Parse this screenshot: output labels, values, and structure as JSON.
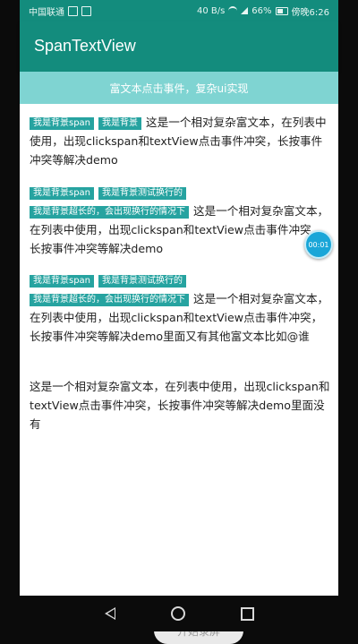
{
  "status_bar": {
    "carrier": "中国联通",
    "net_speed": "40 B/s",
    "battery": "66%",
    "time": "傍晚6:26"
  },
  "app": {
    "title": "SpanTextView"
  },
  "banner": {
    "text": "富文本点击事件，复杂ui实现"
  },
  "paragraphs": [
    {
      "tags": [
        "我是背景span",
        "我是背景"
      ],
      "text": "这是一个相对复杂富文本，在列表中使用，出现clickspan和textView点击事件冲突，长按事件冲突等解决demo"
    },
    {
      "tags": [
        "我是背景span",
        "我是背景测试换行的",
        "我是背景超长的，会出现换行的情况下"
      ],
      "text": "这是一个相对复杂富文本，在列表中使用，出现clickspan和textView点击事件冲突，长按事件冲突等解决demo"
    },
    {
      "tags": [
        "我是背景span",
        "我是背景测试换行的",
        "我是背景超长的，会出现换行的情况下"
      ],
      "text": "这是一个相对复杂富文本，在列表中使用，出现clickspan和textView点击事件冲突，长按事件冲突等解决demo里面又有其他富文本比如@谁"
    },
    {
      "tags": [],
      "text": "这是一个相对复杂富文本，在列表中使用，出现clickspan和textView点击事件冲突，长按事件冲突等解决demo里面没有"
    }
  ],
  "record_button": {
    "label": "开始录屏"
  },
  "timer": {
    "text": "00:01"
  },
  "colors": {
    "primary": "#138c7d",
    "banner": "#7fd4d2",
    "tag": "#26a3a0"
  }
}
